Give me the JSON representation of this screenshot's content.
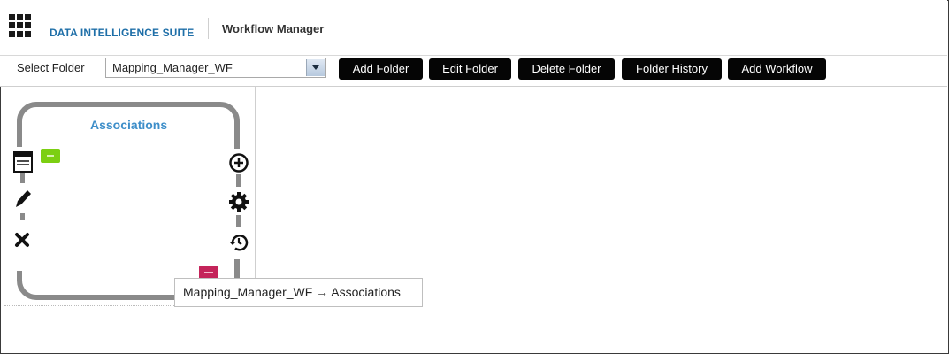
{
  "header": {
    "brand": "DATA INTELLIGENCE SUITE",
    "app_title": "Workflow Manager"
  },
  "toolbar": {
    "select_label": "Select Folder",
    "folder_value": "Mapping_Manager_WF",
    "buttons": {
      "add_folder": "Add Folder",
      "edit_folder": "Edit Folder",
      "delete_folder": "Delete Folder",
      "folder_history": "Folder History",
      "add_workflow": "Add Workflow"
    }
  },
  "workflow_node": {
    "title": "Associations",
    "left_icons": [
      "document-icon",
      "pencil-icon",
      "close-icon"
    ],
    "right_icons": [
      "add-circle-icon",
      "gear-icon",
      "history-icon"
    ],
    "badges": [
      "green-badge",
      "red-badge"
    ]
  },
  "tooltip": {
    "text": "Mapping_Manager_WF → Associations"
  },
  "colors": {
    "brand": "#1f6fa8",
    "node_title": "#3d8ec9",
    "button_bg": "#050505",
    "node_border": "#8a8a8a",
    "badge_green": "#7ccf12",
    "badge_red": "#c4245a"
  }
}
